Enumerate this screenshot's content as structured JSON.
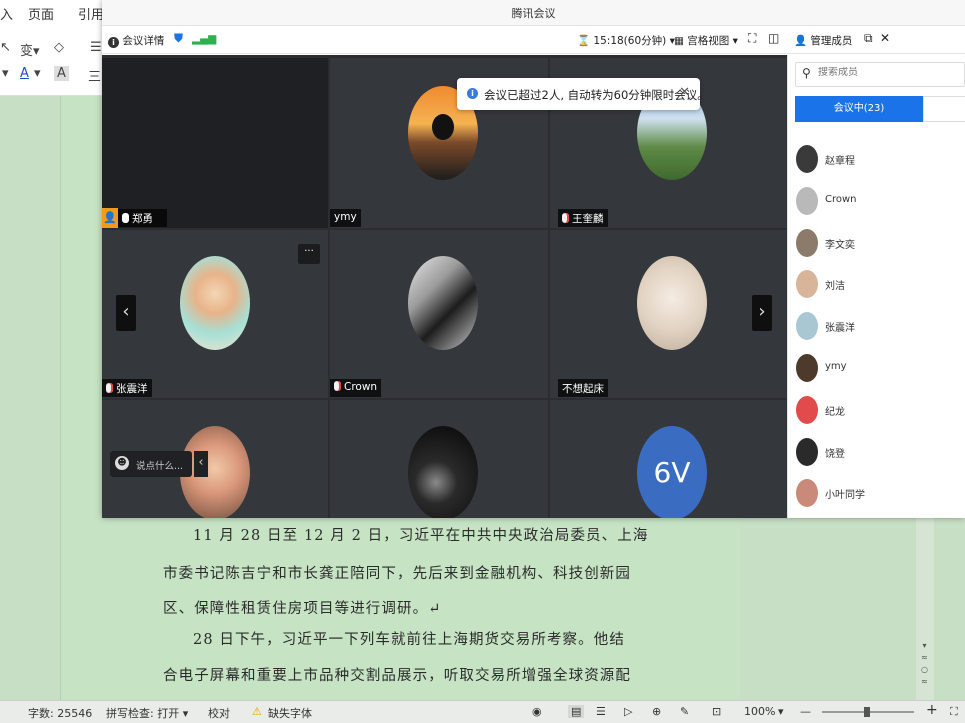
{
  "word": {
    "menu": [
      "入",
      "页面",
      "引用"
    ],
    "paragraphs": [
      "11 月 28 日至 12 月 2 日，习近平在中共中央政治局委员、上海",
      "市委书记陈吉宁和市长龚正陪同下，先后来到金融机构、科技创新园",
      "区、保障性租赁住房项目等进行调研。↵",
      "28 日下午，习近平一下列车就前往上海期货交易所考察。他结",
      "合电子屏幕和重要上市品种交割品展示，听取交易所增强全球资源配"
    ],
    "status": {
      "word_count": "字数: 25546",
      "spell_check": "拼写检查: 打开",
      "proofread": "校对",
      "missing_font": "缺失字体",
      "zoom": "100%"
    }
  },
  "meeting": {
    "window_title": "腾讯会议",
    "toolbar": {
      "details": "会议详情",
      "timer": "15:18(60分钟)",
      "layout": "宫格视图",
      "manage_members": "管理成员"
    },
    "toast": "会议已超过2人, 自动转为60分钟限时会议。",
    "participants": [
      {
        "name": "郑勇",
        "mic": "normal"
      },
      {
        "name": "ymy",
        "mic": "none"
      },
      {
        "name": "王奎麟",
        "mic": "muted"
      },
      {
        "name": "张震洋",
        "mic": "muted"
      },
      {
        "name": "Crown",
        "mic": "muted"
      },
      {
        "name": "不想起床",
        "mic": "none"
      },
      {
        "name": "",
        "mic": "none"
      },
      {
        "name": "",
        "mic": "none"
      },
      {
        "name": "",
        "mic": "none",
        "avatar_text": "6V"
      }
    ],
    "chat_placeholder": "说点什么...",
    "members_panel": {
      "search_placeholder": "搜索成员",
      "tab_label": "会议中(23)",
      "members": [
        "赵章程",
        "Crown",
        "李文奕",
        "刘洁",
        "张震洋",
        "ymy",
        "纪龙",
        "饶登",
        "小叶同学"
      ]
    }
  },
  "colors": {
    "accent": "#1a73e8",
    "stage": "#2b2d31",
    "page_green": "#c6e3c4"
  }
}
